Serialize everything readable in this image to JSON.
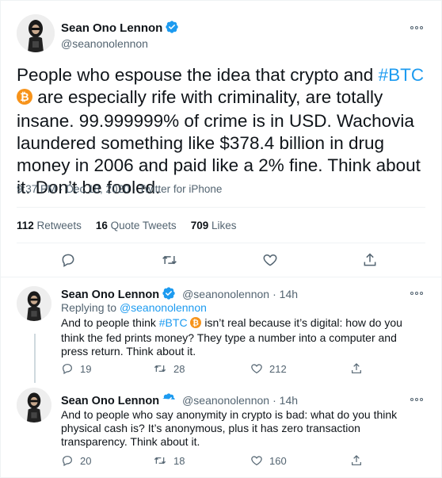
{
  "colors": {
    "accent": "#1d9bf0",
    "secondary_text": "#536471",
    "bitcoin": "#f7931a"
  },
  "tweet": {
    "author_name": "Sean Ono Lennon",
    "author_handle": "@seanonolennon",
    "text_part1": "People who espouse the idea that crypto and ",
    "hashtag": "#BTC",
    "text_part2": " are especially rife with criminality, are totally insane. 99.999999% of crime is in USD. Wachovia laundered something like $378.4 billion in drug money in 2006 and paid like a 2% fine. Think about it. Don’t be fooled.",
    "timestamp": "9:37 PM · Dec 18, 2020 · Twitter for iPhone",
    "retweets_count": "112",
    "retweets_label": "Retweets",
    "quotes_count": "16",
    "quotes_label": "Quote Tweets",
    "likes_count": "709",
    "likes_label": "Likes",
    "icons": [
      "reply-icon",
      "retweet-icon",
      "like-icon",
      "share-icon"
    ]
  },
  "replies": [
    {
      "author_name": "Sean Ono Lennon",
      "author_handle": "@seanonolennon",
      "age": "· 14h",
      "replying_prefix": "Replying to ",
      "replying_handle": "@seanonolennon",
      "text_part1": "And to people think ",
      "hashtag": "#BTC",
      "text_part2": " isn’t real because it’s digital: how do you think the fed prints money? They type a number into a computer and press return. Think about it.",
      "replies": "19",
      "retweets": "28",
      "likes": "212"
    },
    {
      "author_name": "Sean Ono Lennon",
      "author_handle": "@seanonolennon",
      "age": "· 14h",
      "text": "And to people who say anonymity in crypto is bad: what do you think physical cash is? It’s anonymous, plus it has zero transaction transparency. Think about it.",
      "replies": "20",
      "retweets": "18",
      "likes": "160"
    }
  ]
}
